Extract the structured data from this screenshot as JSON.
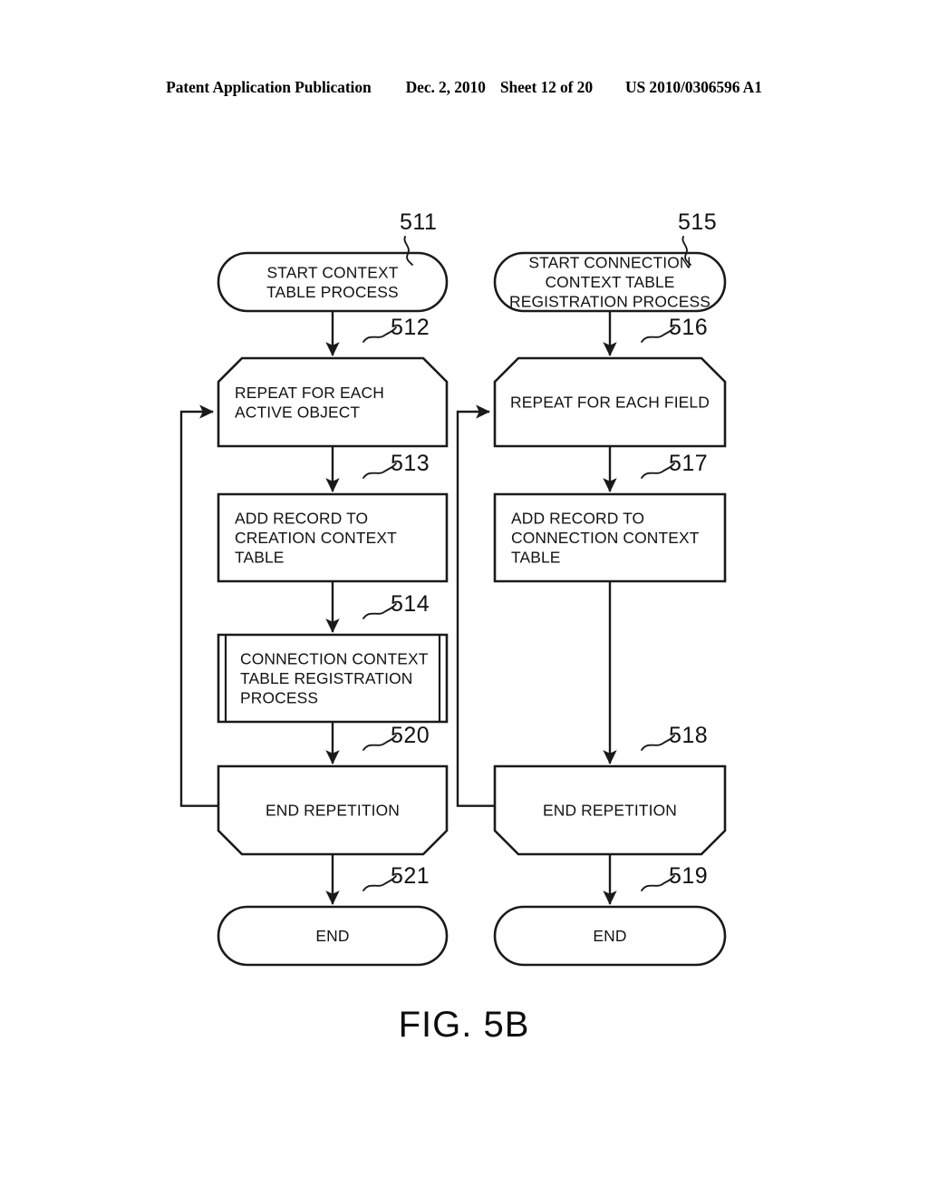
{
  "header": {
    "publication": "Patent Application Publication",
    "date": "Dec. 2, 2010",
    "sheet": "Sheet 12 of 20",
    "patent_number": "US 2010/0306596 A1"
  },
  "figure": {
    "caption": "FIG. 5B"
  },
  "colors": {
    "ink": "#1a1a1a",
    "paper": "#ffffff"
  },
  "flowchart": {
    "columns": [
      {
        "name": "context-table-process",
        "nodes": [
          {
            "ref": "511",
            "shape": "terminator",
            "lines": [
              "START CONTEXT",
              "TABLE PROCESS"
            ],
            "align": "center"
          },
          {
            "ref": "512",
            "shape": "loop-start",
            "lines": [
              "REPEAT FOR EACH",
              "ACTIVE OBJECT"
            ],
            "align": "left"
          },
          {
            "ref": "513",
            "shape": "process",
            "lines": [
              "ADD RECORD TO",
              "CREATION CONTEXT",
              "TABLE"
            ],
            "align": "left"
          },
          {
            "ref": "514",
            "shape": "predefined-process",
            "lines": [
              "CONNECTION CONTEXT",
              "TABLE REGISTRATION",
              "PROCESS"
            ],
            "align": "left"
          },
          {
            "ref": "520",
            "shape": "loop-end",
            "lines": [
              "END REPETITION"
            ],
            "align": "center"
          },
          {
            "ref": "521",
            "shape": "terminator",
            "lines": [
              "END"
            ],
            "align": "center"
          }
        ]
      },
      {
        "name": "connection-context-table-registration-process",
        "nodes": [
          {
            "ref": "515",
            "shape": "terminator",
            "lines": [
              "START CONNECTION",
              "CONTEXT TABLE",
              "REGISTRATION PROCESS"
            ],
            "align": "center"
          },
          {
            "ref": "516",
            "shape": "loop-start",
            "lines": [
              "REPEAT FOR EACH FIELD"
            ],
            "align": "center"
          },
          {
            "ref": "517",
            "shape": "process",
            "lines": [
              "ADD RECORD TO",
              "CONNECTION CONTEXT",
              "TABLE"
            ],
            "align": "left"
          },
          {
            "ref": "518",
            "shape": "loop-end",
            "lines": [
              "END REPETITION"
            ],
            "align": "center"
          },
          {
            "ref": "519",
            "shape": "terminator",
            "lines": [
              "END"
            ],
            "align": "center"
          }
        ]
      }
    ],
    "loopbacks": [
      {
        "name": "left-loopback",
        "from_ref": "520",
        "to_ref": "512"
      },
      {
        "name": "right-loopback",
        "from_ref": "518",
        "to_ref": "516"
      }
    ]
  }
}
